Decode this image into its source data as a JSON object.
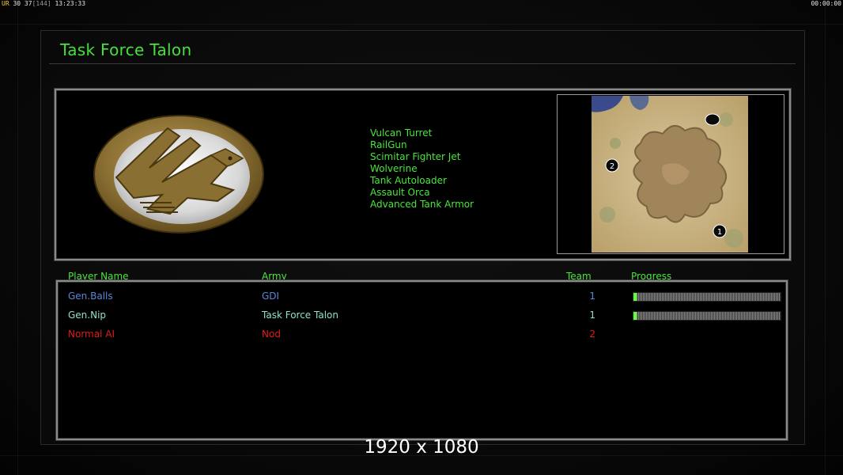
{
  "hud": {
    "ur": "UR",
    "fps": "30 37",
    "bracket": "[144]",
    "clock": "13:23:33",
    "timer": "00:00:00"
  },
  "title": "Task Force Talon",
  "upgrades": [
    "Vulcan Turret",
    "RailGun",
    "Scimitar Fighter Jet",
    "Wolverine",
    "Tank Autoloader",
    "Assault Orca",
    "Advanced Tank Armor"
  ],
  "map": {
    "start_positions": [
      "1",
      "2"
    ]
  },
  "table": {
    "headers": {
      "player": "Player Name",
      "army": "Army",
      "team": "Team",
      "progress": "Progress"
    },
    "rows": [
      {
        "player": "Gen.Balls",
        "army": "GDI",
        "team": "1",
        "color": "#5b86d8",
        "progress": 0.02
      },
      {
        "player": "Gen.Nip",
        "army": "Task Force Talon",
        "team": "1",
        "color": "#8fe0cc",
        "progress": 0.02
      },
      {
        "player": "Normal AI",
        "army": "Nod",
        "team": "2",
        "color": "#e31b1b"
      }
    ]
  },
  "watermark": "1920 x 1080",
  "colors": {
    "accent_green": "#49e63c",
    "gdi_blue": "#5b86d8",
    "talon_teal": "#8fe0cc",
    "nod_red": "#e31b1b"
  }
}
